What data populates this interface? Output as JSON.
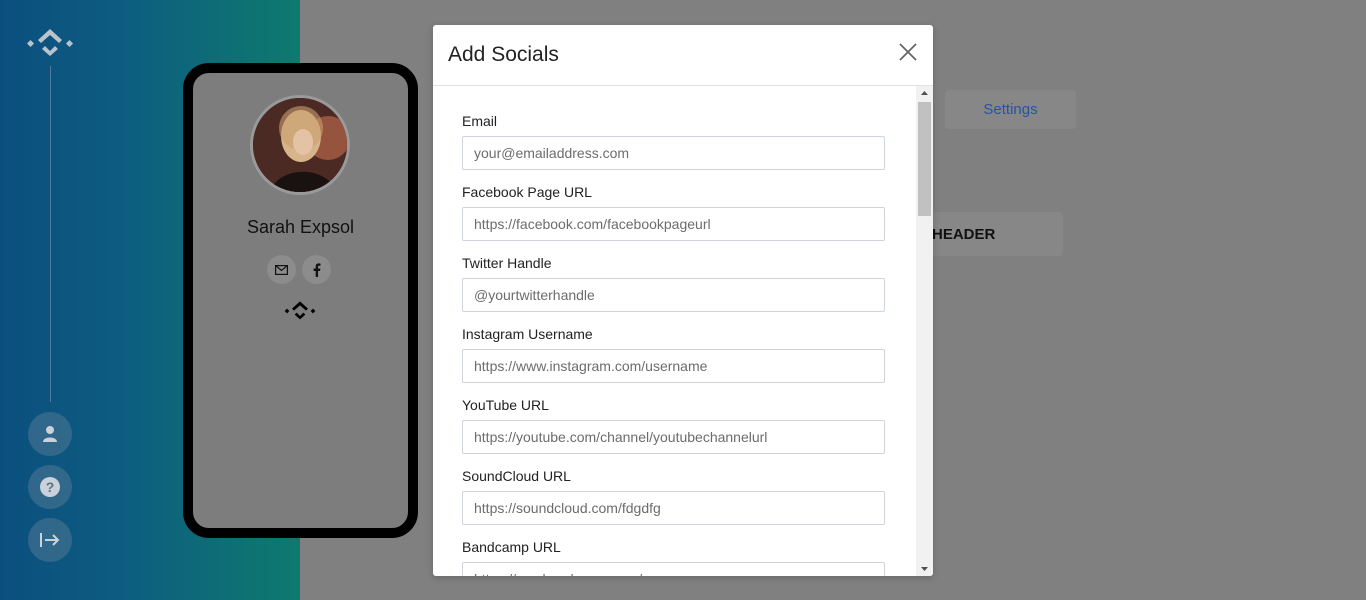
{
  "profile": {
    "name": "Sarah Expsol"
  },
  "background": {
    "settings_label": "Settings",
    "header_label": "HEADER"
  },
  "modal": {
    "title": "Add Socials",
    "fields": [
      {
        "label": "Email",
        "placeholder": "your@emailaddress.com"
      },
      {
        "label": "Facebook Page URL",
        "placeholder": "https://facebook.com/facebookpageurl"
      },
      {
        "label": "Twitter Handle",
        "placeholder": "@yourtwitterhandle"
      },
      {
        "label": "Instagram Username",
        "placeholder": "https://www.instagram.com/username"
      },
      {
        "label": "YouTube URL",
        "placeholder": "https://youtube.com/channel/youtubechannelurl"
      },
      {
        "label": "SoundCloud URL",
        "placeholder": "https://soundcloud.com/fdgdfg"
      },
      {
        "label": "Bandcamp URL",
        "placeholder": "https://you.bandcamp.com/"
      }
    ]
  },
  "icons": {
    "logo": "brand-diamond-icon",
    "user": "user-icon",
    "help": "help-icon",
    "logout": "logout-icon",
    "email": "email-icon",
    "facebook": "facebook-icon",
    "close": "close-icon"
  },
  "colors": {
    "overlay_gray": "#808080",
    "gradient_start": "#0b4f7f",
    "gradient_end": "#0e7a6e",
    "settings_link": "#2454a8"
  }
}
